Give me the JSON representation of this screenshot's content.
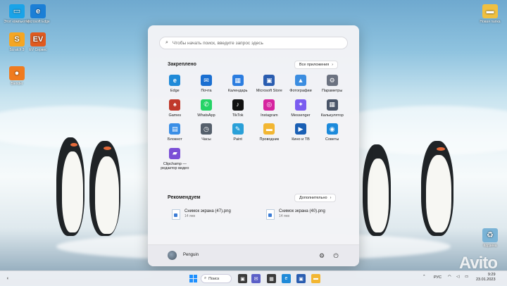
{
  "desktop": {
    "icons": [
      {
        "label": "Этот компьютер",
        "glyph": "▭",
        "color": "#1aa3e8"
      },
      {
        "label": "Microsoft Edge",
        "glyph": "e",
        "color": "#1b7fd6"
      },
      {
        "label": "Scratch 3",
        "glyph": "S",
        "color": "#f5a623"
      },
      {
        "label": "EV Сервис",
        "glyph": "EV",
        "color": "#e05a1f"
      },
      {
        "label": "Blender",
        "glyph": "●",
        "color": "#f07b1f"
      },
      {
        "label": "Новая папка",
        "glyph": "▬",
        "color": "#f0c040"
      },
      {
        "label": "Корзина",
        "glyph": "♻",
        "color": "#7ab3d6"
      }
    ]
  },
  "start_menu": {
    "search_placeholder": "Чтобы начать поиск, введите запрос здесь",
    "pinned_title": "Закреплено",
    "all_apps_label": "Все приложения",
    "pinned_apps": [
      {
        "label": "Edge",
        "color": "#1f8ad8",
        "glyph": "e"
      },
      {
        "label": "Почта",
        "color": "#1a6fd1",
        "glyph": "✉"
      },
      {
        "label": "Календарь",
        "color": "#2b7de0",
        "glyph": "▦"
      },
      {
        "label": "Microsoft Store",
        "color": "#2a5db0",
        "glyph": "▣"
      },
      {
        "label": "Фотографии",
        "color": "#3b8de0",
        "glyph": "▲"
      },
      {
        "label": "Параметры",
        "color": "#6b7280",
        "glyph": "⚙"
      },
      {
        "label": "Games",
        "color": "#c0392b",
        "glyph": "♠"
      },
      {
        "label": "WhatsApp",
        "color": "#25d366",
        "glyph": "✆"
      },
      {
        "label": "TikTok",
        "color": "#111111",
        "glyph": "♪"
      },
      {
        "label": "Instagram",
        "color": "#d6249f",
        "glyph": "◎"
      },
      {
        "label": "Messenger",
        "color": "#7a5cf0",
        "glyph": "✦"
      },
      {
        "label": "Калькулятор",
        "color": "#4a5568",
        "glyph": "▦"
      },
      {
        "label": "Блокнот",
        "color": "#3a8ee6",
        "glyph": "▤"
      },
      {
        "label": "Часы",
        "color": "#555f6b",
        "glyph": "◷"
      },
      {
        "label": "Paint",
        "color": "#2aa0d8",
        "glyph": "✎"
      },
      {
        "label": "Проводник",
        "color": "#f2b632",
        "glyph": "▬"
      },
      {
        "label": "Кино и ТВ",
        "color": "#1a5fb4",
        "glyph": "▶"
      },
      {
        "label": "Советы",
        "color": "#1c8adb",
        "glyph": "◉"
      },
      {
        "label": "Clipchamp — редактор видео",
        "color": "#7b4fd6",
        "glyph": "▰"
      }
    ],
    "recommended_title": "Рекомендуем",
    "more_label": "Дополнительно",
    "recommended": [
      {
        "name": "Снимок экрана (47).png",
        "meta": "14 янв"
      },
      {
        "name": "Снимок экрана (40).png",
        "meta": "14 янв"
      }
    ],
    "user_name": "Penguin"
  },
  "taskbar": {
    "search_label": "Поиск",
    "language": "РУС",
    "time": "9:29",
    "date": "23.01.2023"
  }
}
